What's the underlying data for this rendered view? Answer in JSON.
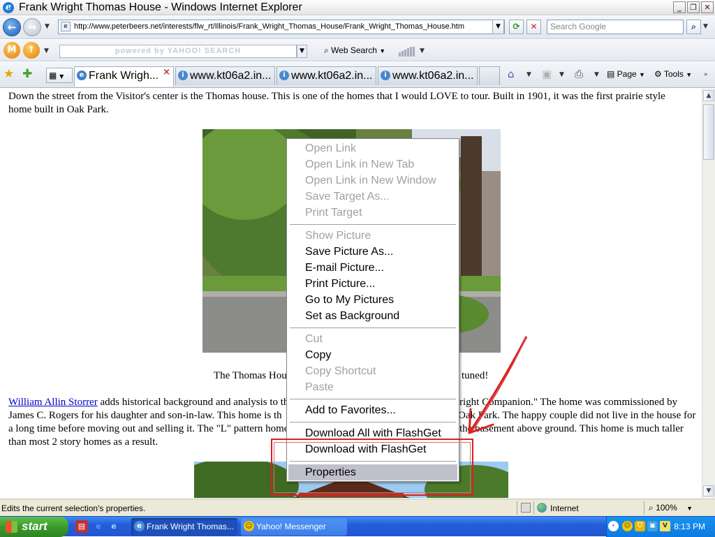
{
  "window": {
    "title": "Frank Wright Thomas House - Windows Internet Explorer"
  },
  "address_bar": {
    "url": "http://www.peterbeers.net/interests/flw_rt/Illinois/Frank_Wright_Thomas_House/Frank_Wright_Thomas_House.htm",
    "search_placeholder": "Search Google"
  },
  "yahoo_toolbar": {
    "search_placeholder": "powered by YAHOO! SEARCH",
    "web_search_label": "Web Search"
  },
  "tabs": [
    {
      "label": "Frank Wrigh...",
      "active": true
    },
    {
      "label": "www.kt06a2.in...",
      "active": false
    },
    {
      "label": "www.kt06a2.in...",
      "active": false
    },
    {
      "label": "www.kt06a2.in...",
      "active": false
    }
  ],
  "command_bar": {
    "page_label": "Page",
    "tools_label": "Tools"
  },
  "page": {
    "intro_line1": "Down the street from the Visitor's center is the Thomas house.  This is one of the homes that I would LOVE to tour.   Built in 1901, it was the first prairie style",
    "intro_line2": "home built in Oak Park.",
    "caption_left": "The Thomas Hou",
    "caption_right": "tuned!",
    "storrer_link": "William Allin Storrer",
    "p2_line1_rest": " adds historical background and analysis to thi",
    "p2_line1_right": "right Companion.\"  The home was commissioned by",
    "p2_line2_left": "James C. Rogers for his daughter and son-in-law.  This home is th",
    "p2_line2_right": "Oak Park.  The happy couple did not live in the house for",
    "p2_line3_left": "a long time before moving out and selling it.  The \"L\" pattern home",
    "p2_line3_right": "the basement above ground.  This home is much taller",
    "p2_line4": "than most 2 story homes as a result."
  },
  "context_menu": {
    "items": [
      {
        "label": "Open Link",
        "disabled": true
      },
      {
        "label": "Open Link in New Tab",
        "disabled": true
      },
      {
        "label": "Open Link in New Window",
        "disabled": true
      },
      {
        "label": "Save Target As...",
        "disabled": true
      },
      {
        "label": "Print Target",
        "disabled": true
      },
      {
        "label": "Show Picture",
        "disabled": true
      },
      {
        "label": "Save Picture As...",
        "disabled": false
      },
      {
        "label": "E-mail Picture...",
        "disabled": false
      },
      {
        "label": "Print Picture...",
        "disabled": false
      },
      {
        "label": "Go to My Pictures",
        "disabled": false
      },
      {
        "label": "Set as Background",
        "disabled": false
      },
      {
        "label": "Cut",
        "disabled": true
      },
      {
        "label": "Copy",
        "disabled": false
      },
      {
        "label": "Copy Shortcut",
        "disabled": true
      },
      {
        "label": "Paste",
        "disabled": true
      },
      {
        "label": "Add to Favorites...",
        "disabled": false
      },
      {
        "label": "Download All with FlashGet",
        "disabled": false
      },
      {
        "label": "Download with FlashGet",
        "disabled": false
      },
      {
        "label": "Properties",
        "disabled": false,
        "highlighted": true
      }
    ]
  },
  "status_bar": {
    "text": "Edits the current selection's properties.",
    "zone": "Internet",
    "zoom": "100%"
  },
  "taskbar": {
    "start_label": "start",
    "buttons": [
      {
        "label": "Frank Wright Thomas...",
        "active": true
      },
      {
        "label": "Yahoo! Messenger",
        "active": false
      }
    ],
    "clock": "8:13 PM"
  },
  "colors": {
    "annotation_red": "#d52222",
    "menu_highlight": "#c0c0cc",
    "link_blue": "#0000cc"
  }
}
